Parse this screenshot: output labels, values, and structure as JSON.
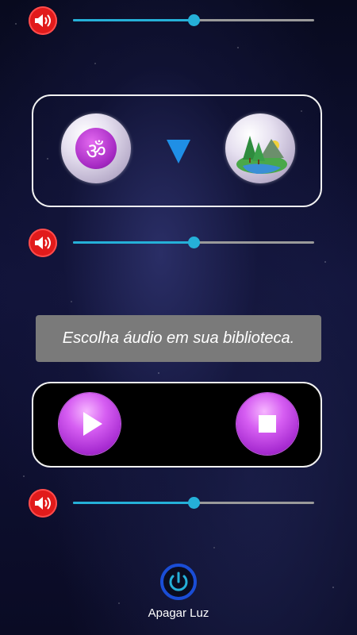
{
  "volume_sliders": [
    {
      "name": "volume-1",
      "level": 0.5
    },
    {
      "name": "volume-2",
      "level": 0.5
    },
    {
      "name": "volume-3",
      "level": 0.5
    }
  ],
  "sound_selector": {
    "left_icon": "om-icon",
    "middle_icon": "arrow-down-icon",
    "right_icon": "landscape-icon"
  },
  "toast": {
    "message": "Escolha áudio em sua biblioteca."
  },
  "player": {
    "play_icon": "play-icon",
    "stop_icon": "stop-icon"
  },
  "footer": {
    "power_icon": "power-icon",
    "power_label": "Apagar Luz"
  },
  "colors": {
    "accent": "#25b0d8",
    "speaker": "#e11b1b",
    "arrow": "#1f8fe6",
    "button_purple": "#c94ae8",
    "power_ring": "#1a4dd6"
  }
}
